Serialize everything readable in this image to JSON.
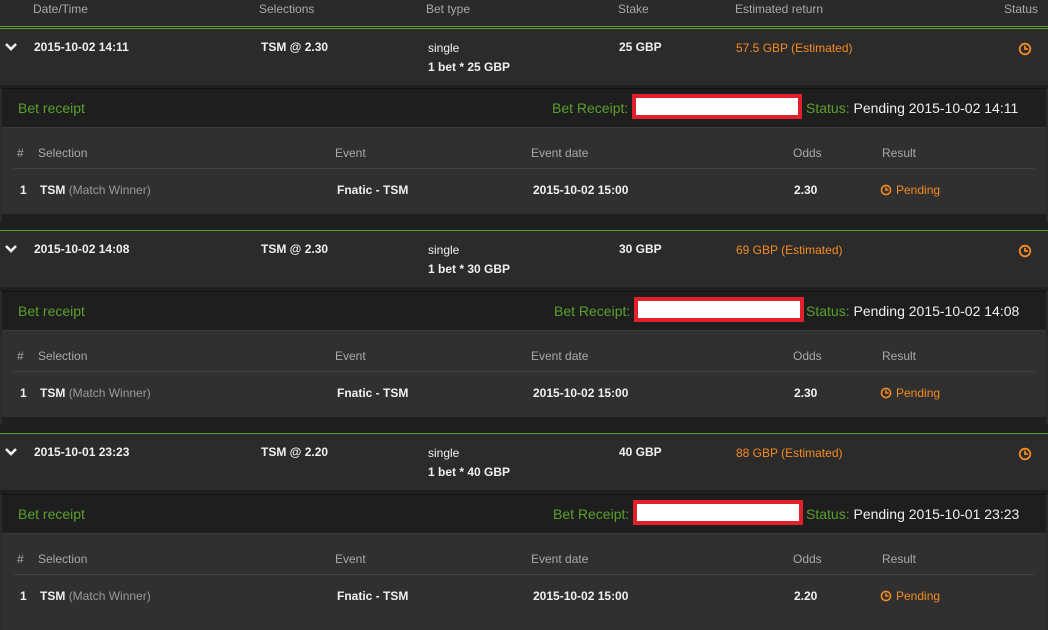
{
  "columns": {
    "datetime": "Date/Time",
    "selections": "Selections",
    "bet_type": "Bet type",
    "stake": "Stake",
    "estimated_return": "Estimated return",
    "status": "Status"
  },
  "receipt_labels": {
    "title": "Bet receipt",
    "receipt_label": "Bet Receipt:",
    "status_label": "Status:",
    "col_num": "#",
    "col_selection": "Selection",
    "col_event": "Event",
    "col_event_date": "Event date",
    "col_odds": "Odds",
    "col_result": "Result"
  },
  "bets": [
    {
      "datetime": "2015-10-02 14:11",
      "selection": "TSM @ 2.30",
      "bet_type": "single",
      "bet_detail": "1 bet * 25 GBP",
      "stake": "25 GBP",
      "est_return": "57.5 GBP (Estimated)",
      "receipt_status": "Pending 2015-10-02 14:11",
      "row": {
        "num": "1",
        "selection": "TSM",
        "market": "(Match Winner)",
        "event": "Fnatic - TSM",
        "event_date": "2015-10-02 15:00",
        "odds": "2.30",
        "result": "Pending"
      }
    },
    {
      "datetime": "2015-10-02 14:08",
      "selection": "TSM @ 2.30",
      "bet_type": "single",
      "bet_detail": "1 bet * 30 GBP",
      "stake": "30 GBP",
      "est_return": "69 GBP (Estimated)",
      "receipt_status": "Pending 2015-10-02 14:08",
      "row": {
        "num": "1",
        "selection": "TSM",
        "market": "(Match Winner)",
        "event": "Fnatic - TSM",
        "event_date": "2015-10-02 15:00",
        "odds": "2.30",
        "result": "Pending"
      }
    },
    {
      "datetime": "2015-10-01 23:23",
      "selection": "TSM @ 2.20",
      "bet_type": "single",
      "bet_detail": "1 bet * 40 GBP",
      "stake": "40 GBP",
      "est_return": "88 GBP (Estimated)",
      "receipt_status": "Pending 2015-10-01 23:23",
      "row": {
        "num": "1",
        "selection": "TSM",
        "market": "(Match Winner)",
        "event": "Fnatic - TSM",
        "event_date": "2015-10-02 15:00",
        "odds": "2.20",
        "result": "Pending"
      }
    }
  ],
  "colors": {
    "accent_green": "#5aa02c",
    "accent_orange": "#f58b22",
    "redact_border": "#e0202a"
  },
  "icons": {
    "expand": "chevron-down-icon",
    "status": "clock-icon",
    "result": "clock-icon"
  }
}
